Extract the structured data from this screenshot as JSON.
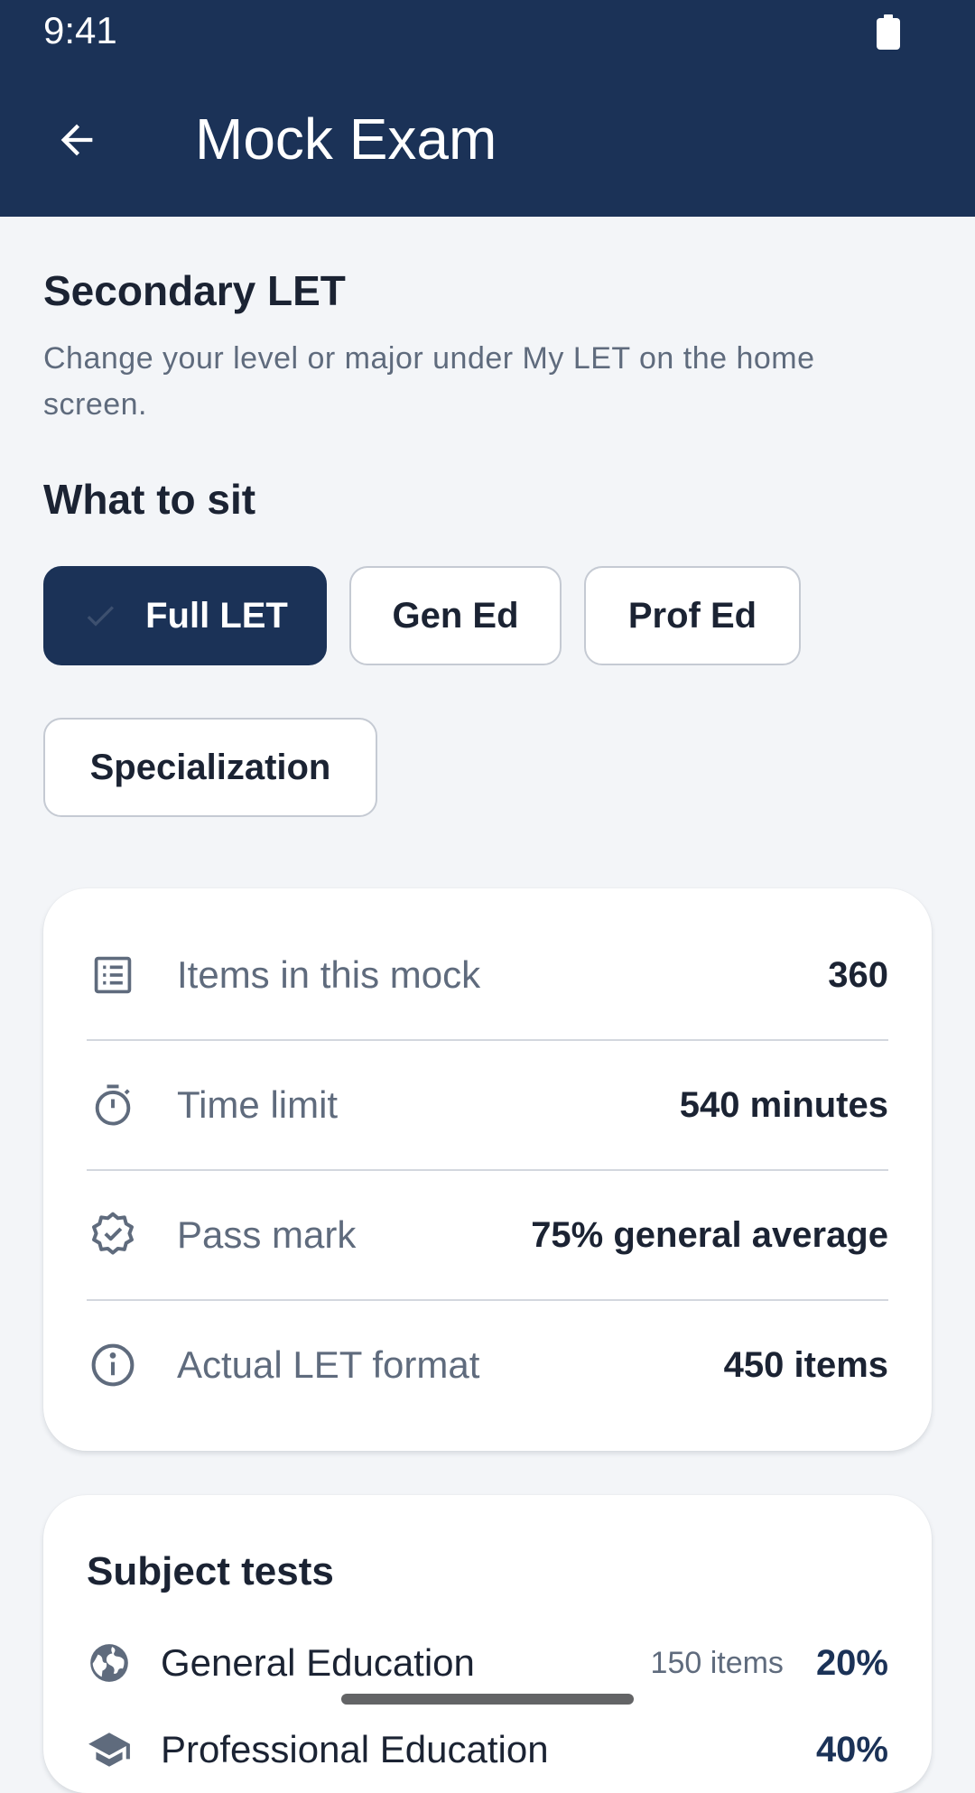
{
  "status_bar": {
    "time": "9:41"
  },
  "app_bar": {
    "title": "Mock Exam"
  },
  "level": {
    "title": "Secondary LET",
    "hint": "Change your level or major under My LET on the home screen."
  },
  "what_to_sit": {
    "heading": "What to sit",
    "options": [
      {
        "label": "Full LET",
        "selected": true
      },
      {
        "label": "Gen Ed",
        "selected": false
      },
      {
        "label": "Prof Ed",
        "selected": false
      },
      {
        "label": "Specialization",
        "selected": false
      }
    ]
  },
  "summary": {
    "rows": [
      {
        "icon": "list-icon",
        "label": "Items in this mock",
        "value": "360"
      },
      {
        "icon": "timer-icon",
        "label": "Time limit",
        "value": "540 minutes"
      },
      {
        "icon": "verified-badge-icon",
        "label": "Pass mark",
        "value": "75% general average"
      },
      {
        "icon": "info-icon",
        "label": "Actual LET format",
        "value": "450 items"
      }
    ]
  },
  "subject_tests": {
    "heading": "Subject tests",
    "items": [
      {
        "icon": "globe-icon",
        "name": "General Education",
        "count": "150 items",
        "percent": "20%"
      },
      {
        "icon": "school-icon",
        "name": "Professional Education",
        "count": "",
        "percent": "40%"
      }
    ]
  },
  "colors": {
    "primary": "#1b3257",
    "background": "#f3f5f8",
    "card": "#ffffff",
    "muted_text": "#5f6b7d"
  }
}
